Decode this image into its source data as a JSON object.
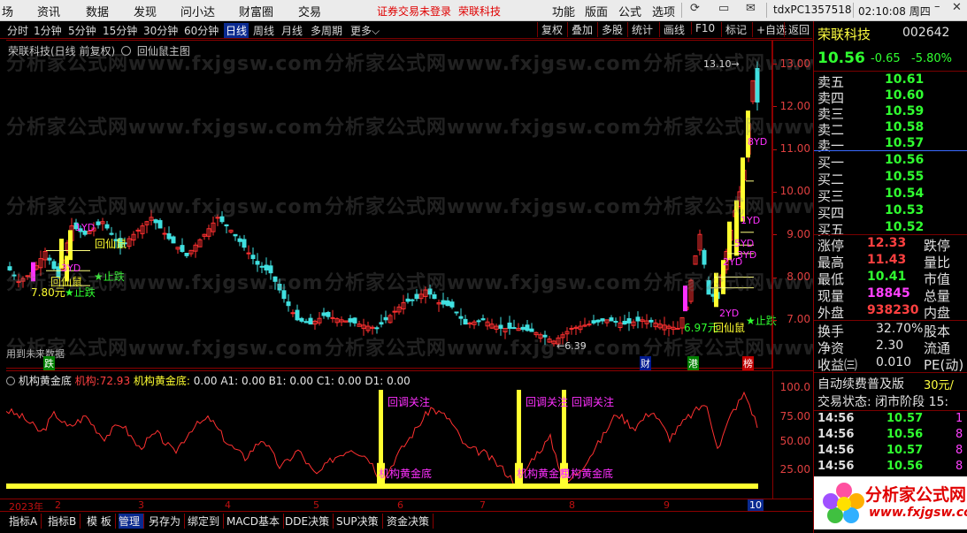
{
  "menubar": {
    "items": [
      "场",
      "资讯",
      "数据",
      "发现",
      "问小达",
      "财富圈",
      "交易"
    ],
    "notice": "证券交易未登录",
    "stock_name": "荣联科技",
    "right_items": [
      "功能",
      "版面",
      "公式",
      "选项"
    ],
    "user": "tdxPC1357518",
    "clock": "02:10:08 周四"
  },
  "toolbar": {
    "periods": [
      "分时",
      "1分钟",
      "5分钟",
      "15分钟",
      "30分钟",
      "60分钟",
      "日线",
      "周线",
      "月线",
      "多周期",
      "更多"
    ],
    "active": "日线",
    "right": [
      "复权",
      "叠加",
      "多股",
      "统计",
      "画线",
      "F10",
      "标记",
      "+自选",
      "返回"
    ]
  },
  "chart": {
    "title_stock": "荣联科技(日线 前复权)",
    "title_indicator": "回仙鼠主图",
    "price_labels": [
      "13.00",
      "12.00",
      "11.00",
      "10.00",
      "9.00",
      "8.00",
      "7.00"
    ],
    "high_label": "13.10",
    "low_label": "6.39",
    "future_label": "用到未来数据",
    "annotations": {
      "a1": "回仙鼠",
      "a2": "7.80元",
      "a3": "★止跌",
      "a4": "1YD",
      "a5": "3YD",
      "a6": "回仙鼠",
      "a7": "★止跌",
      "a8": "6.97元",
      "a9": "回仙鼠",
      "a10": "★止跌",
      "a11": "2YD",
      "a12": "3YD",
      "a13": "8YD",
      "a14": "1YD",
      "a15": "2YD",
      "a16": "5YD",
      "a17": "跌",
      "a18": "财",
      "a19": "港",
      "a20": "榜"
    }
  },
  "subchart": {
    "name": "机构黄金底",
    "t1": "机构:",
    "t1v": "72.93",
    "t2": "机构黄金底:",
    "t2v": "0.00",
    "t3": "A1:",
    "t3v": "0.00",
    "t4": "B1:",
    "t4v": "0.00",
    "t5": "C1:",
    "t5v": "0.00",
    "t6": "D1:",
    "t6v": "0.00",
    "axis": [
      "100.0",
      "75.00",
      "50.00",
      "25.00"
    ],
    "signal_top": "回调关注",
    "signal_bottom": "机构黄金底"
  },
  "dates": [
    "2023年",
    "2",
    "3",
    "4",
    "5",
    "6",
    "7",
    "8",
    "9",
    "10"
  ],
  "tabs": [
    "指标A",
    "指标B",
    "模 板",
    "管理",
    "另存为",
    "绑定到",
    "MACD基本",
    "DDE决策",
    "SUP决策",
    "资金决策"
  ],
  "quote": {
    "name": "荣联科技",
    "code": "002642",
    "price": "10.56",
    "change": "-0.65",
    "pct": "-5.80%",
    "asks": [
      [
        "卖五",
        "10.61"
      ],
      [
        "卖四",
        "10.60"
      ],
      [
        "卖三",
        "10.59"
      ],
      [
        "卖二",
        "10.58"
      ],
      [
        "卖一",
        "10.57"
      ]
    ],
    "bids": [
      [
        "买一",
        "10.56"
      ],
      [
        "买二",
        "10.55"
      ],
      [
        "买三",
        "10.54"
      ],
      [
        "买四",
        "10.53"
      ],
      [
        "买五",
        "10.52"
      ]
    ],
    "stats": [
      [
        "涨停",
        "12.33",
        "跌停"
      ],
      [
        "最高",
        "11.43",
        "量比"
      ],
      [
        "最低",
        "10.41",
        "市值"
      ],
      [
        "现量",
        "18845",
        "总量"
      ],
      [
        "外盘",
        "938230",
        "内盘"
      ]
    ],
    "stats2": [
      [
        "换手",
        "32.70%",
        "股本"
      ],
      [
        "净资",
        "2.30",
        "流通"
      ],
      [
        "收益㈢",
        "0.010",
        "PE(动)"
      ]
    ],
    "promo": "自动续费普及版",
    "promo_price": "30元/",
    "trade_status": "交易状态: 闭市阶段 15:",
    "ticks": [
      [
        "14:56",
        "10.57",
        "1"
      ],
      [
        "14:56",
        "10.56",
        "8"
      ],
      [
        "14:56",
        "10.57",
        "8"
      ],
      [
        "14:56",
        "10.56",
        "8"
      ],
      [
        "14:56",
        "",
        ""
      ]
    ]
  },
  "watermark": "分析家公式网www.fxjgsw.com",
  "logo": {
    "cn": "分析家公式网",
    "url": "www.fxjgsw.com"
  },
  "colors": {
    "up": "#ff3030",
    "down": "#30e0e0",
    "yellow": "#ffff30",
    "magenta": "#ff30ff",
    "green": "#30ff30",
    "axis": "#c01010"
  }
}
